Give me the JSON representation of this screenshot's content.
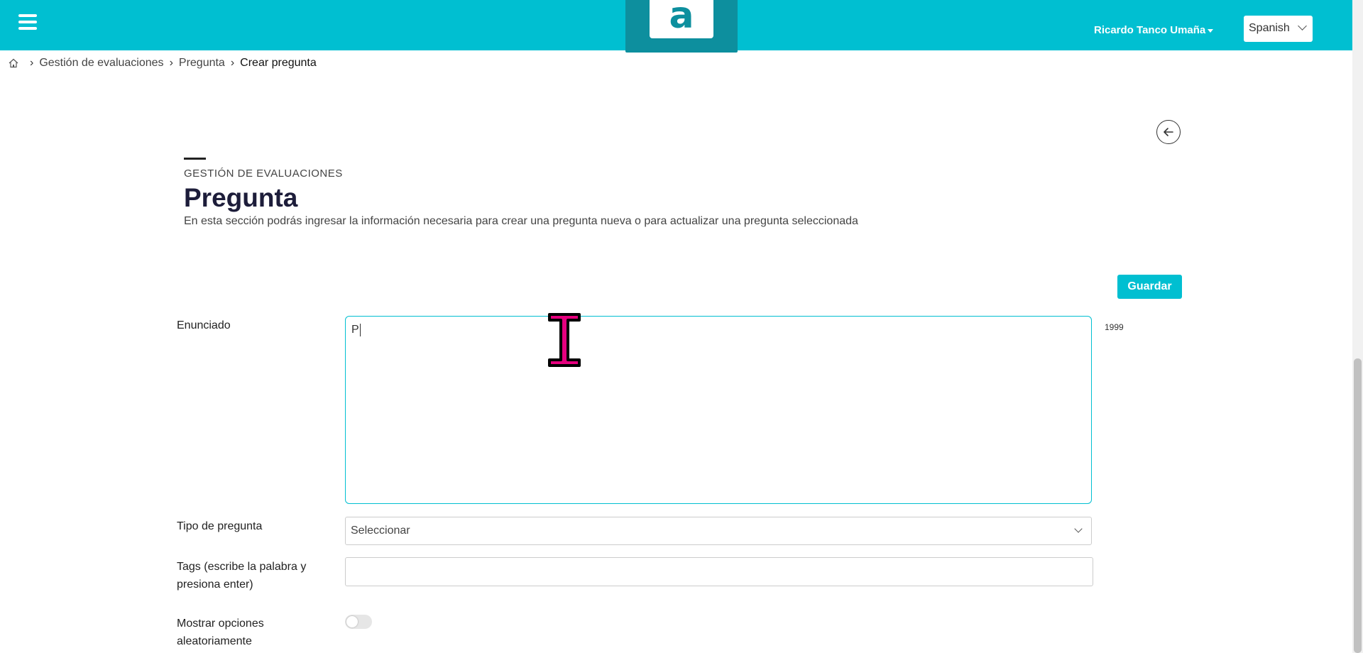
{
  "header": {
    "logo_letter": "a",
    "user_name": "Ricardo Tanco Umaña",
    "language": "Spanish",
    "brand_color": "#00bfd1",
    "logo_color": "#0d8f9e"
  },
  "breadcrumb": {
    "items": [
      "Gestión de evaluaciones",
      "Pregunta",
      "Crear pregunta"
    ]
  },
  "page": {
    "eyebrow": "GESTIÓN DE EVALUACIONES",
    "title": "Pregunta",
    "description": "En esta sección podrás ingresar la información necesaria para crear una pregunta nueva o para actualizar una pregunta seleccionada"
  },
  "toolbar": {
    "save_label": "Guardar"
  },
  "form": {
    "enunciado": {
      "label": "Enunciado",
      "value": "P",
      "remaining_chars": "1999"
    },
    "tipo": {
      "label": "Tipo de pregunta",
      "selected": "Seleccionar"
    },
    "tags": {
      "label_line1": "Tags (escribe la palabra y",
      "label_line2": "presiona enter)",
      "value": ""
    },
    "random": {
      "label_line1": "Mostrar opciones",
      "label_line2": "aleatoriamente",
      "enabled": false
    }
  },
  "icons": {
    "menu": "hamburger-menu-icon",
    "home": "home-icon",
    "back": "arrow-left-circle-icon",
    "cursor": "text-cursor-ibeam-icon"
  }
}
